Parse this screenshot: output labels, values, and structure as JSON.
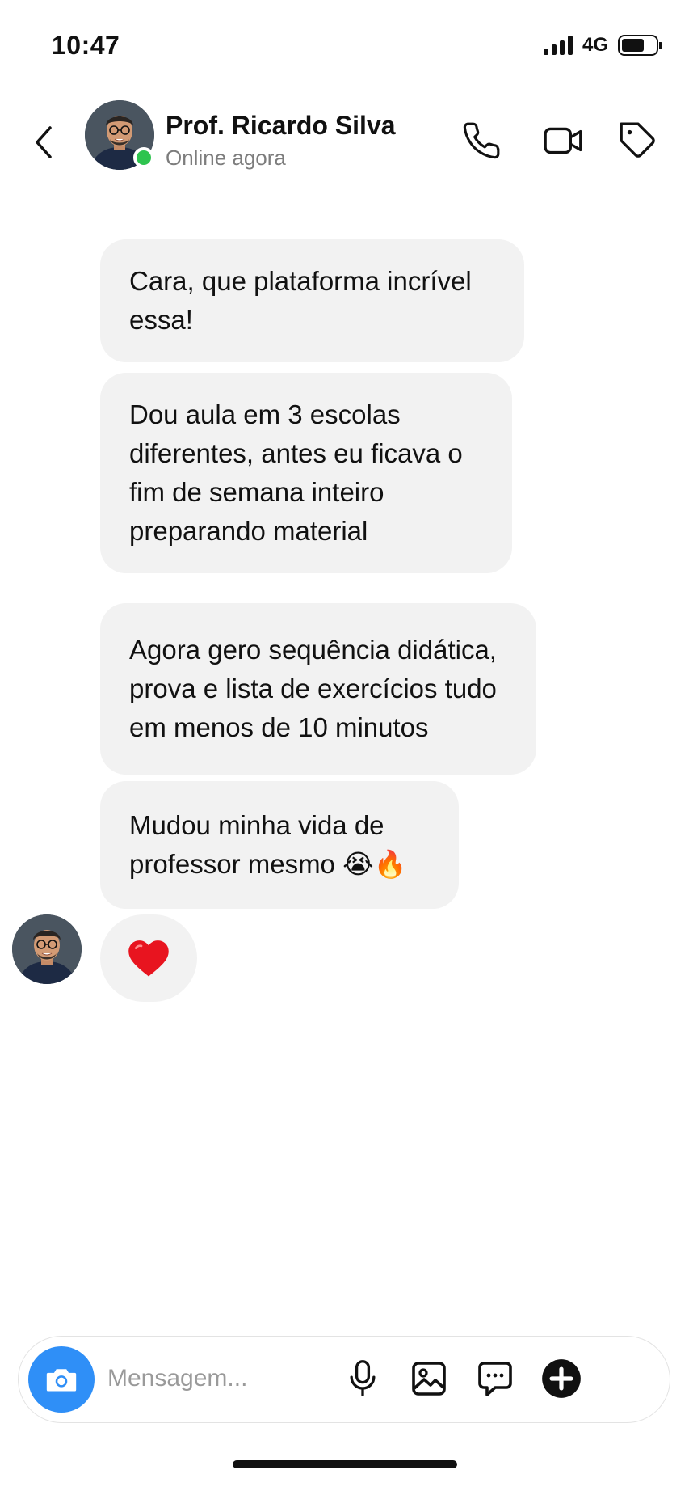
{
  "status_bar": {
    "time": "10:47",
    "network": "4G"
  },
  "header": {
    "contact_name": "Prof. Ricardo Silva",
    "contact_status": "Online agora"
  },
  "messages": [
    {
      "text": "Cara, que plataforma incrível essa!"
    },
    {
      "text": "Dou aula em 3 escolas diferentes, antes eu ficava o fim de semana inteiro preparando material"
    },
    {
      "text": "Agora gero sequência didática, prova e lista de exercícios tudo em menos de 10 minutos"
    },
    {
      "text": "Mudou minha vida de professor mesmo 😭🔥"
    }
  ],
  "reaction": {
    "emoji": "❤️"
  },
  "composer": {
    "placeholder": "Mensagem..."
  },
  "colors": {
    "accent": "#2f8ff7",
    "online": "#2ec44f",
    "bubble": "#f2f2f2"
  },
  "icons": [
    "chevron-left-icon",
    "phone-icon",
    "video-camera-icon",
    "tag-icon",
    "camera-icon",
    "microphone-icon",
    "image-icon",
    "chat-bubble-icon",
    "plus-icon"
  ]
}
